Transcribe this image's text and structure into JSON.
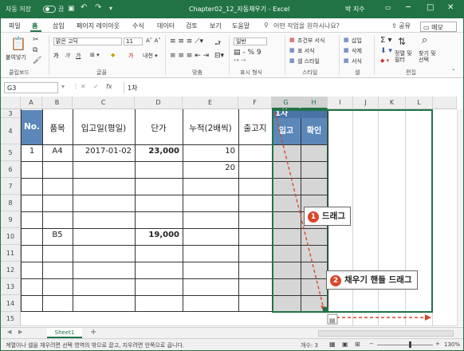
{
  "titlebar": {
    "autosave": "자동 저장",
    "toggle_state": "끔",
    "title": "Chapter02_12_자동채우기 - Excel",
    "user": "박 지수",
    "minimize": "─",
    "restore": "□",
    "close": "✕",
    "save_icon": "💾",
    "undo": "↶",
    "redo": "↷"
  },
  "menu": {
    "items": [
      "파일",
      "홈",
      "삽입",
      "페이지 레이아웃",
      "수식",
      "데이터",
      "검토",
      "보기",
      "도움말"
    ],
    "search": "어떤 작업을 원하시나요?",
    "share": "공유",
    "memo": "메모"
  },
  "ribbon": {
    "paste": "붙여넣기",
    "clipboard": "클립보드",
    "font_name": "맑은 고딕",
    "font_size": "11",
    "font_group": "글꼴",
    "align_group": "맞춤",
    "number_format": "일반",
    "number_group": "표시 형식",
    "cond_format": "조건부 서식",
    "table_format": "표 서식",
    "cell_style": "셀 스타일",
    "style_group": "스타일",
    "insert": "삽입",
    "delete": "삭제",
    "format": "서식",
    "cells_group": "셀",
    "sort": "정렬 및 필터",
    "find": "찾기 및 선택",
    "edit_group": "편집"
  },
  "formula_bar": {
    "cell_ref": "G3",
    "fx": "fx",
    "value": "1차"
  },
  "grid": {
    "columns": [
      "A",
      "B",
      "C",
      "D",
      "E",
      "F",
      "G",
      "H",
      "I",
      "J",
      "K",
      "L"
    ],
    "rows": [
      "3",
      "4",
      "5",
      "6",
      "7",
      "8",
      "9",
      "10",
      "11",
      "12",
      "13",
      "14",
      "15"
    ],
    "headers": {
      "no": "No.",
      "item": "품목",
      "date": "입고일(평일)",
      "price": "단가",
      "cumulative": "누적(2배씩)",
      "out": "출고지",
      "first": "1차",
      "in": "입고",
      "confirm": "확인"
    },
    "row5": {
      "no": "1",
      "item": "A4",
      "date": "2017-01-02",
      "price": "23,000",
      "cum": "10"
    },
    "row6": {
      "cum": "20"
    },
    "row10": {
      "item": "B5",
      "price": "19,000"
    }
  },
  "callouts": {
    "drag": "드래그",
    "fill_handle_drag": "채우기 핸들 드래그",
    "n1": "1",
    "n2": "2"
  },
  "sheets": {
    "active": "Sheet1",
    "add": "+"
  },
  "status": {
    "message": "계열이나 셀을 채우려면 선택 영역의 밖으로 끌고, 지우려면 안쪽으로 끕니다.",
    "count": "개수: 3",
    "zoom": "130%"
  },
  "colors": {
    "accent": "#217346",
    "header_blue": "#5b87b9",
    "callout_red": "#d9472b"
  }
}
